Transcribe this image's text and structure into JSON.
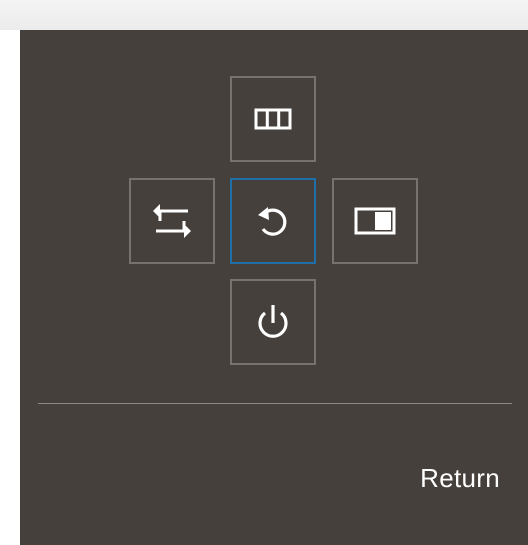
{
  "osd": {
    "buttons": {
      "up": {
        "icon": "column-layout-icon"
      },
      "left": {
        "icon": "swap-arrows-icon"
      },
      "center": {
        "icon": "return-arrow-icon",
        "selected": true
      },
      "right": {
        "icon": "picture-mode-icon"
      },
      "down": {
        "icon": "power-icon"
      }
    },
    "selected_color": "#1f6fa8",
    "footer": {
      "label": "Return"
    }
  }
}
